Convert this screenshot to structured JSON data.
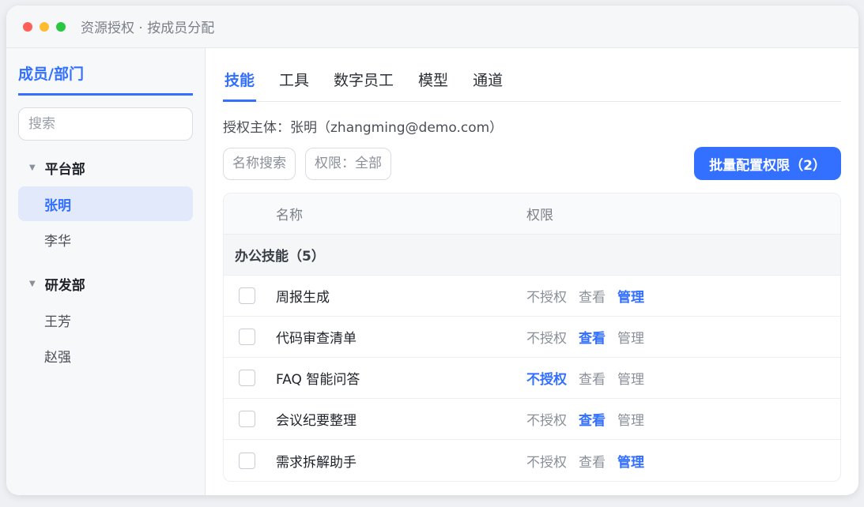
{
  "window": {
    "title": "资源授权 · 按成员分配"
  },
  "sidebar": {
    "title": "成员/部门",
    "search_placeholder": "搜索",
    "departments": [
      {
        "name": "平台部",
        "members": [
          "张明",
          "李华"
        ]
      },
      {
        "name": "研发部",
        "members": [
          "王芳",
          "赵强"
        ]
      }
    ],
    "selected_member": "张明"
  },
  "tabs": [
    "技能",
    "工具",
    "数字员工",
    "模型",
    "通道"
  ],
  "active_tab": "技能",
  "subject": "授权主体：张明（zhangming@demo.com）",
  "toolbar": {
    "name_search": "名称搜索",
    "permission_filter": "权限：全部",
    "batch_button": "批量配置权限（2）"
  },
  "table": {
    "columns": [
      "名称",
      "权限"
    ],
    "group": "办公技能（5）",
    "permission_options": [
      "不授权",
      "查看",
      "管理"
    ],
    "rows": [
      {
        "name": "周报生成",
        "permission": "管理"
      },
      {
        "name": "代码审查清单",
        "permission": "查看"
      },
      {
        "name": "FAQ 智能问答",
        "permission": "不授权"
      },
      {
        "name": "会议纪要整理",
        "permission": "查看"
      },
      {
        "name": "需求拆解助手",
        "permission": "管理"
      }
    ]
  },
  "colors": {
    "accent": "#3370ff",
    "selected_bg": "#e1e9fb"
  }
}
